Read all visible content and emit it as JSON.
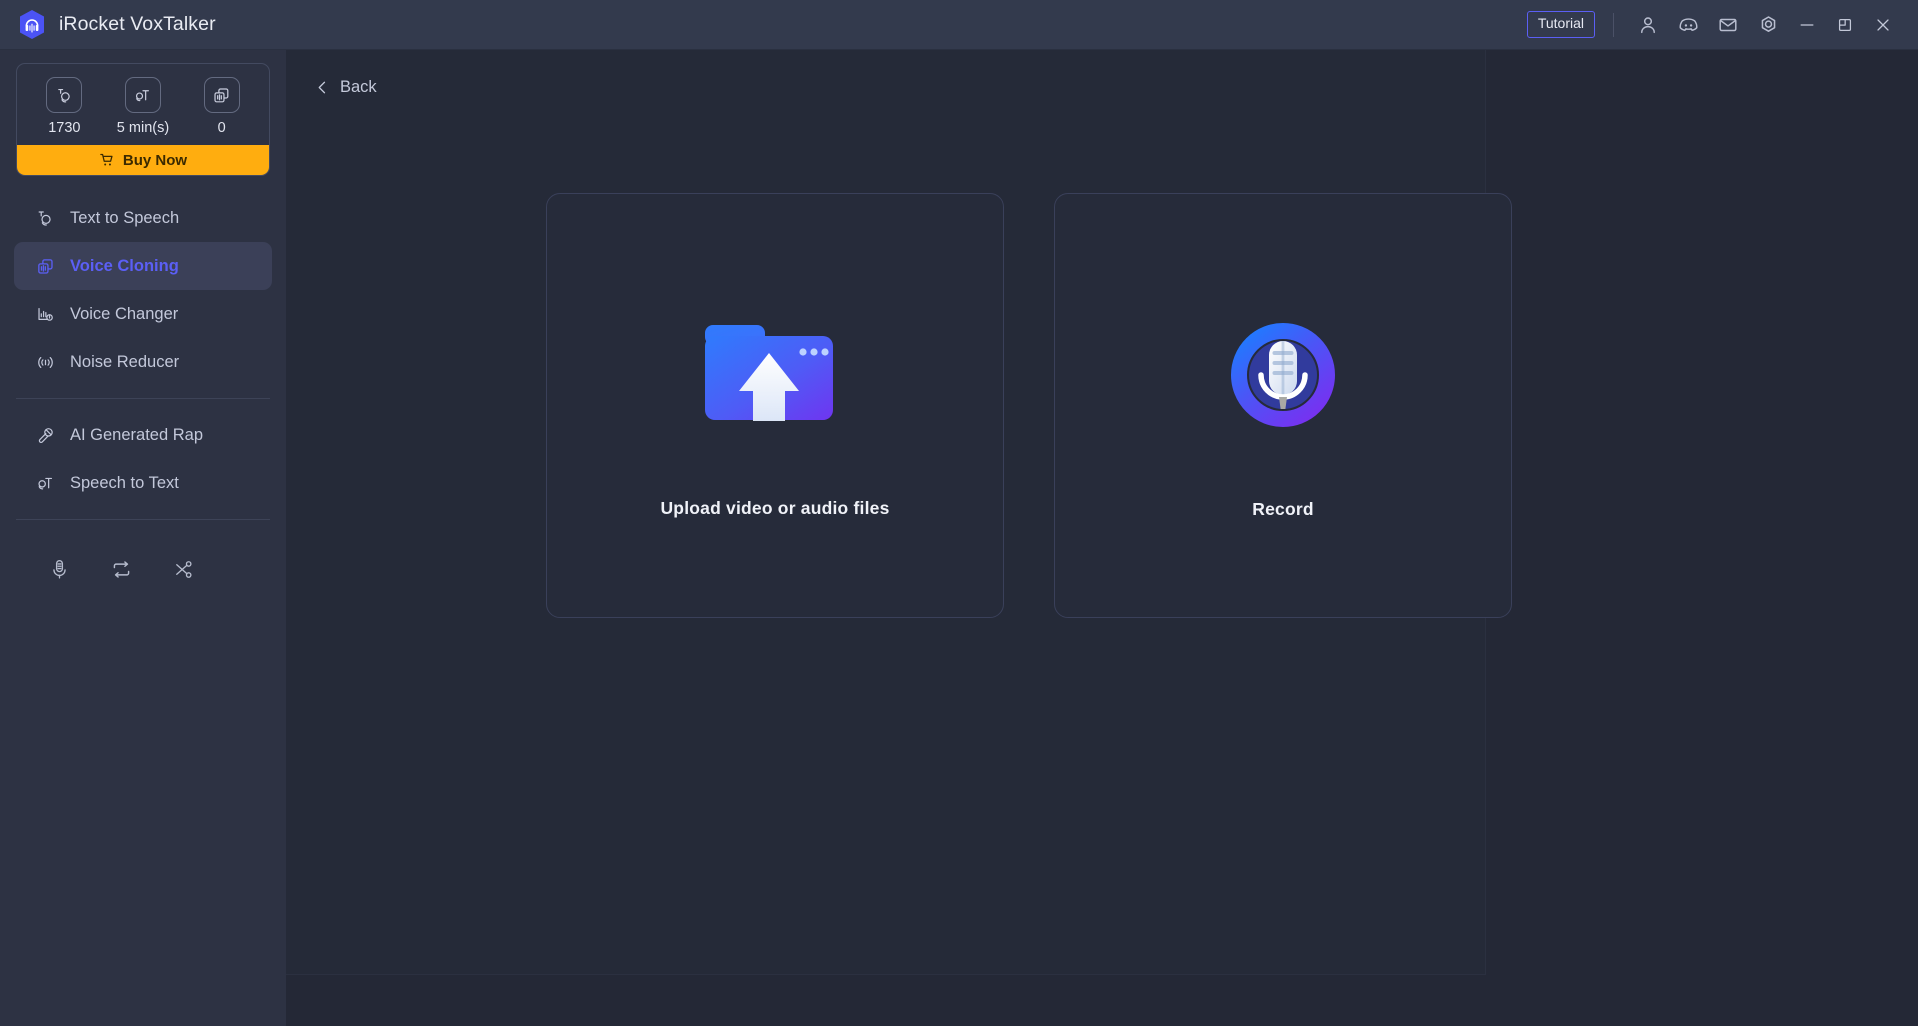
{
  "app": {
    "title": "iRocket VoxTalker",
    "logo_icon": "headphones-hexagon-logo"
  },
  "titlebar": {
    "tutorial_label": "Tutorial",
    "icons": [
      {
        "name": "account-icon",
        "label": "Account"
      },
      {
        "name": "discord-icon",
        "label": "Discord"
      },
      {
        "name": "mail-icon",
        "label": "Feedback"
      },
      {
        "name": "settings-icon",
        "label": "Settings"
      }
    ],
    "window_controls": [
      {
        "name": "minimize-button",
        "label": "Minimize"
      },
      {
        "name": "maximize-button",
        "label": "Maximize"
      },
      {
        "name": "close-button",
        "label": "Close"
      }
    ]
  },
  "sidebar": {
    "credits": [
      {
        "icon": "text-to-speech-credit-icon",
        "value": "1730"
      },
      {
        "icon": "speech-to-text-credit-icon",
        "value": "5 min(s)"
      },
      {
        "icon": "voice-clone-credit-icon",
        "value": "0"
      }
    ],
    "buy_now_label": "Buy Now",
    "buy_now_icon": "cart-icon",
    "items": [
      {
        "icon": "text-to-speech-icon",
        "label": "Text to Speech",
        "active": false
      },
      {
        "icon": "voice-cloning-icon",
        "label": "Voice Cloning",
        "active": true
      },
      {
        "icon": "voice-changer-icon",
        "label": "Voice Changer",
        "active": false
      },
      {
        "icon": "noise-reducer-icon",
        "label": "Noise Reducer",
        "active": false
      },
      {
        "icon": "ai-generated-rap-icon",
        "label": "AI Generated Rap",
        "active": false
      },
      {
        "icon": "speech-to-text-icon",
        "label": "Speech to Text",
        "active": false
      }
    ],
    "tools": [
      {
        "icon": "microphone-icon",
        "label": "Recorder"
      },
      {
        "icon": "loop-icon",
        "label": "Converter"
      },
      {
        "icon": "scissors-icon",
        "label": "Cutter"
      }
    ]
  },
  "main": {
    "back_label": "Back",
    "back_icon": "chevron-left-icon",
    "cards": [
      {
        "name": "upload-card",
        "icon": "upload-folder-icon",
        "label": "Upload video or audio files"
      },
      {
        "name": "record-card",
        "icon": "microphone-record-icon",
        "label": "Record"
      }
    ]
  },
  "colors": {
    "accent_blue": "#5b5ff5",
    "accent_orange": "#ffad0f",
    "sidebar_bg": "#2d3243",
    "titlebar_bg": "#333a4d",
    "main_bg": "#242836",
    "card_bg": "#262b3a",
    "card_border": "#3a405a"
  }
}
